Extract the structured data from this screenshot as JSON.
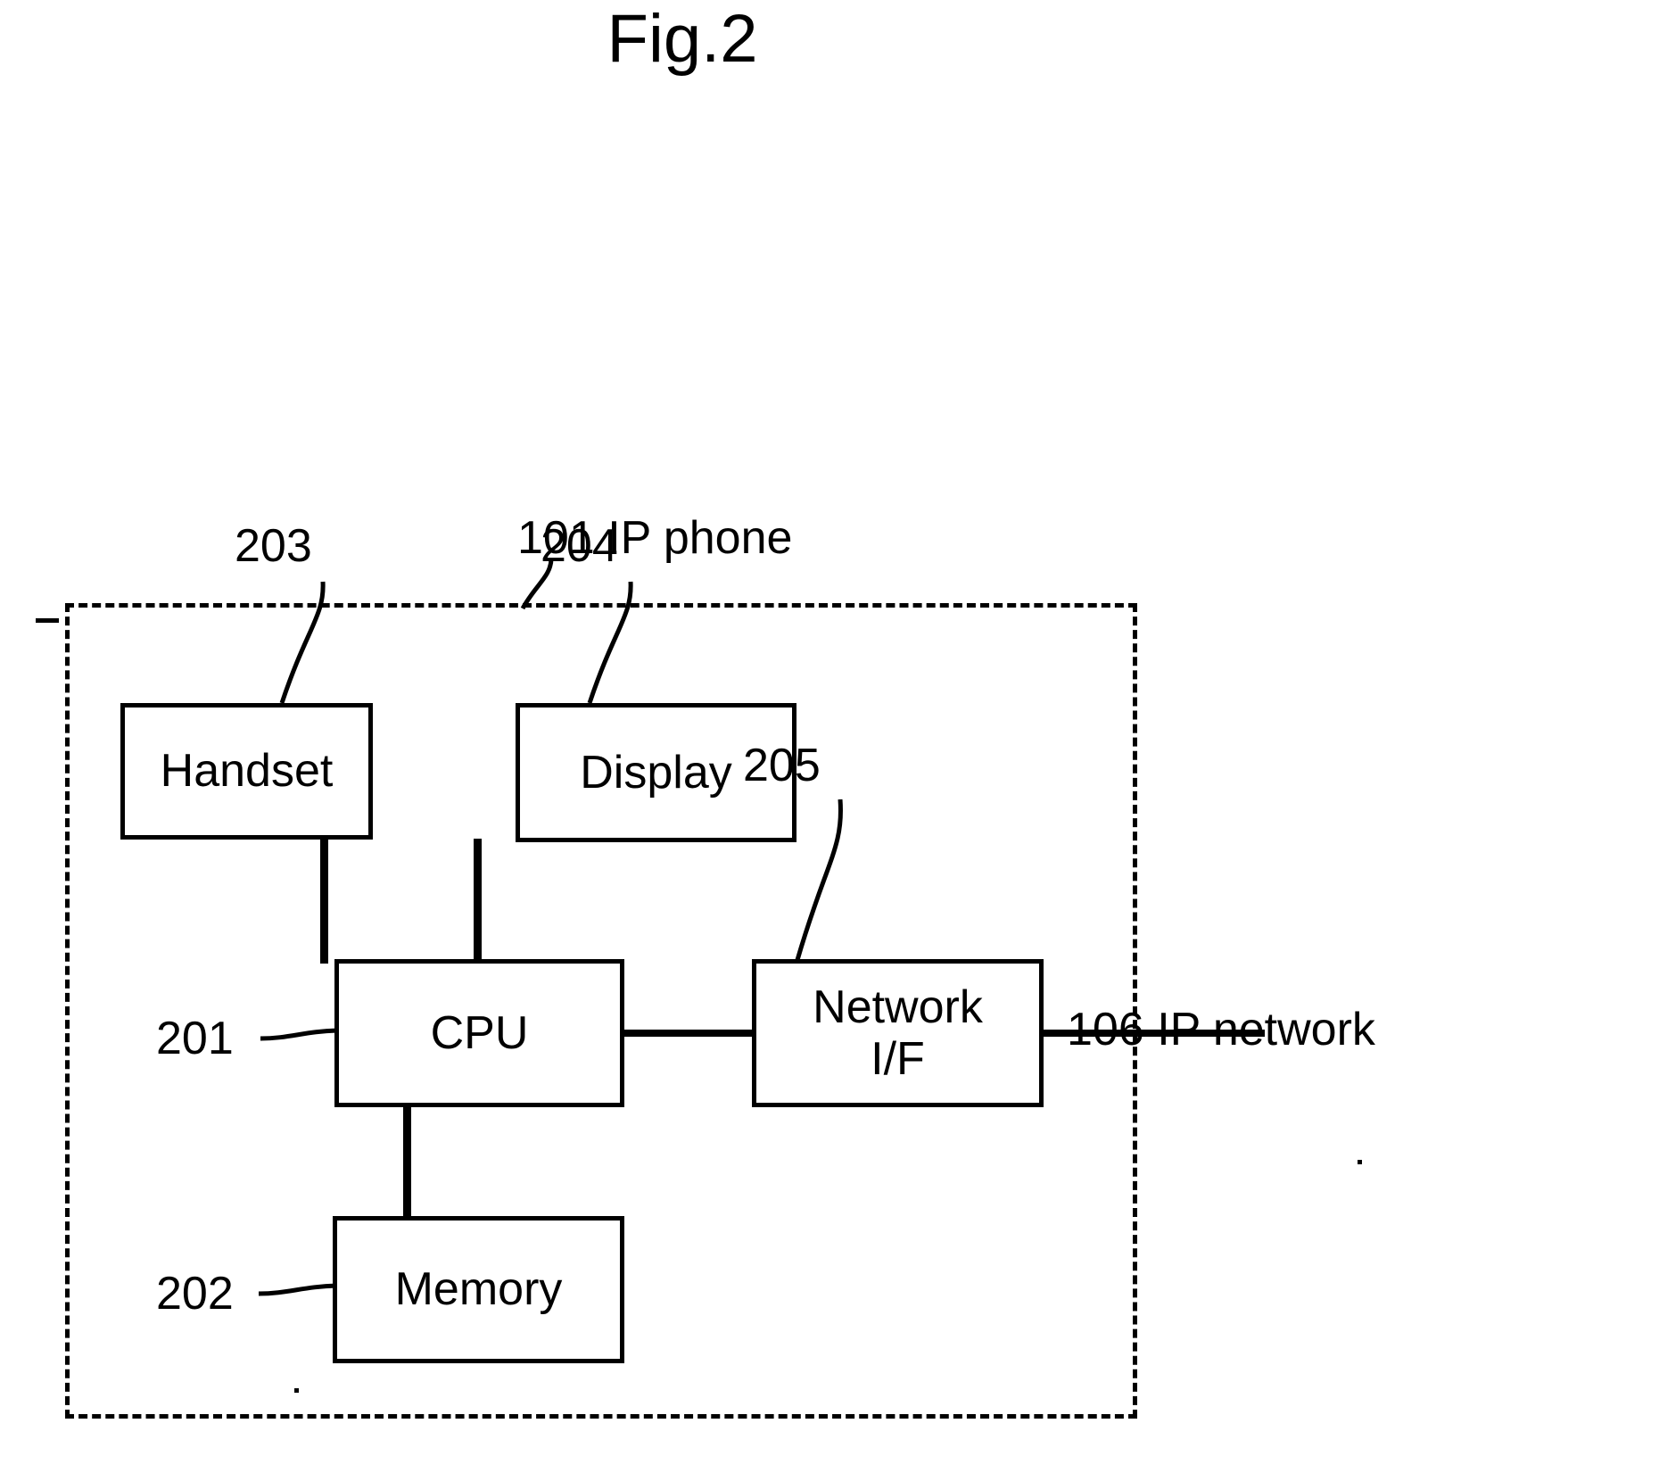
{
  "figure": {
    "title": "Fig.2",
    "enclosure_label": "101 IP phone",
    "external_label": "106 IP network"
  },
  "blocks": [
    {
      "id": "handset",
      "label": "Handset",
      "ref": "203"
    },
    {
      "id": "display",
      "label": "Display",
      "ref": "204"
    },
    {
      "id": "cpu",
      "label": "CPU",
      "ref": "201"
    },
    {
      "id": "netif",
      "label": "Network\nI/F",
      "ref": "205"
    },
    {
      "id": "memory",
      "label": "Memory",
      "ref": "202"
    }
  ],
  "block_labels": {
    "handset": "Handset",
    "display": "Display",
    "cpu": "CPU",
    "netif_line1": "Network",
    "netif_line2": "I/F",
    "memory": "Memory"
  },
  "reference_numerals": {
    "ip_phone": "101 IP phone",
    "cpu": "201",
    "memory": "202",
    "handset": "203",
    "display": "204",
    "network_if": "205",
    "ip_network": "106 IP network"
  },
  "connections": [
    {
      "from": "handset",
      "to": "cpu",
      "style": "solid"
    },
    {
      "from": "display",
      "to": "cpu",
      "style": "solid"
    },
    {
      "from": "cpu",
      "to": "netif",
      "style": "solid"
    },
    {
      "from": "cpu",
      "to": "memory",
      "style": "solid"
    },
    {
      "from": "netif",
      "to": "ip_network",
      "style": "solid"
    }
  ],
  "style": {
    "ink": "#000000",
    "paper": "#ffffff",
    "enclosure_border": "dashed"
  }
}
